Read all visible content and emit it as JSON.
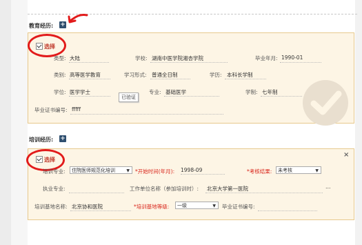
{
  "education": {
    "title": "教育经历:",
    "add_label": "+",
    "select_label": "选择",
    "verified_badge": "已验证",
    "fields": {
      "type_label": "类型:",
      "type_value": "大陆",
      "school_label": "学校:",
      "school_value": "湖南中医学院湘杏学院",
      "grad_year_label": "毕业年月:",
      "grad_year_value": "1990-01",
      "category_label": "类别:",
      "category_value": "高等医学教育",
      "study_form_label": "学习形式:",
      "study_form_value": "普通全日制",
      "edu_level_label": "学历:",
      "edu_level_value": "本科长学制",
      "degree_label": "学位:",
      "degree_value": "医学学士",
      "major_label": "专业:",
      "major_value": "基础医学",
      "system_label": "学制:",
      "system_value": "七年制",
      "cert_no_label": "毕业证书编号:",
      "cert_no_value": "fffff"
    }
  },
  "training": {
    "title": "培训经历:",
    "add_label": "+",
    "select_label": "选择",
    "close_label": "×",
    "fields": {
      "major_label": "培训专业:",
      "major_value": "住院医师规范化培训",
      "start_label": "*开始时间(年月):",
      "start_value": "1998-09",
      "result_label": "*考核结果:",
      "result_value": "未考核",
      "practice_label": "执业专业:",
      "unit_label": "工作单位名称（参加培训时）:",
      "unit_value": "北京大学第一医院",
      "ellipsis": "…",
      "base_label": "培训基地名称:",
      "base_value": "北京协和医院",
      "base_level_label": "*培训基地等级:",
      "base_level_value": "一级",
      "cert_label": "毕业证书编号:"
    }
  },
  "colors": {
    "annotation": "#e21b1b",
    "card_bg": "#fdf5e5",
    "card_border": "#e7c98d",
    "add_button": "#2f4f6f"
  }
}
